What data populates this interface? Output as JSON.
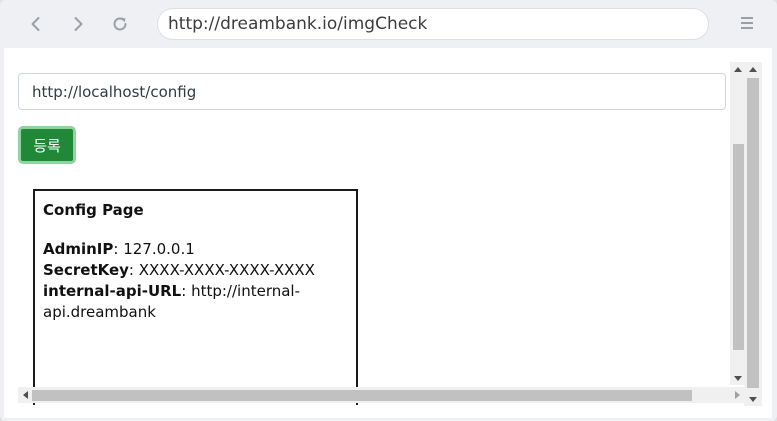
{
  "browser": {
    "url": "http://dreambank.io/imgCheck",
    "back_icon": "chevron-left-icon",
    "forward_icon": "chevron-right-icon",
    "reload_icon": "reload-icon",
    "menu_icon": "hamburger-menu-icon"
  },
  "form": {
    "url_input_value": "http://localhost/config",
    "submit_label": "등록",
    "submit_color": "#218838"
  },
  "result": {
    "title": "Config Page",
    "fields": [
      {
        "key": "AdminIP",
        "sep": ": ",
        "value": "127.0.0.1"
      },
      {
        "key": "SecretKey",
        "sep": ": ",
        "value": "XXXX-XXXX-XXXX-XXXX"
      },
      {
        "key": "internal-api-URL",
        "sep": ": ",
        "value": "http://internal-api.dreambank"
      }
    ]
  }
}
